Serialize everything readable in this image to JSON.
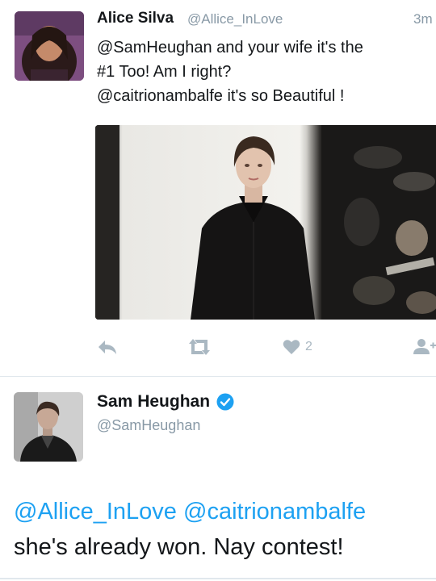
{
  "tweets": [
    {
      "author_name": "Alice Silva",
      "author_handle": "@Allice_InLove",
      "timestamp": "3m",
      "text_lines": [
        "@SamHeughan and your wife  it's the",
        "#1 Too! Am I right?",
        "@caitrionambalfe it's so Beautiful !"
      ],
      "has_photo": true,
      "actions": {
        "reply_icon": "reply-icon",
        "retweet_icon": "retweet-icon",
        "like_icon": "heart-icon",
        "like_count": "2",
        "follow_icon": "follow-icon"
      }
    },
    {
      "author_name": "Sam Heughan",
      "author_handle": "@SamHeughan",
      "verified": true,
      "mentions": [
        "@Allice_InLove",
        "@caitrionambalfe"
      ],
      "body": "she's already won. Nay contest!"
    }
  ],
  "colors": {
    "link": "#1da1f2",
    "muted": "#8899a6",
    "icon": "#aab8c2",
    "text": "#14171a",
    "divider": "#e1e8ed"
  }
}
